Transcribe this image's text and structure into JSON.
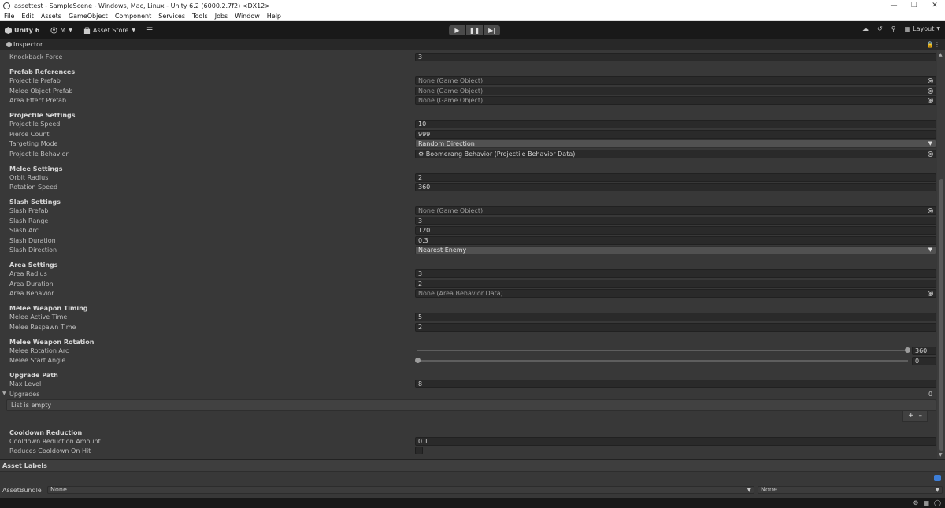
{
  "window": {
    "title": "assettest - SampleScene - Windows, Mac, Linux - Unity 6.2 (6000.2.7f2) <DX12>"
  },
  "menu": [
    "File",
    "Edit",
    "Assets",
    "GameObject",
    "Component",
    "Services",
    "Tools",
    "Jobs",
    "Window",
    "Help"
  ],
  "toolbar": {
    "unity_label": "Unity 6",
    "account_label": "M",
    "asset_store_label": "Asset Store",
    "layout_label": "Layout"
  },
  "inspector": {
    "tab_label": "Inspector"
  },
  "fields": {
    "knockback_force": {
      "label": "Knockback Force",
      "value": "3"
    },
    "prefab_references": "Prefab References",
    "projectile_prefab": {
      "label": "Projectile Prefab",
      "value": "None (Game Object)"
    },
    "melee_object_prefab": {
      "label": "Melee Object Prefab",
      "value": "None (Game Object)"
    },
    "area_effect_prefab": {
      "label": "Area Effect Prefab",
      "value": "None (Game Object)"
    },
    "projectile_settings": "Projectile Settings",
    "projectile_speed": {
      "label": "Projectile Speed",
      "value": "10"
    },
    "pierce_count": {
      "label": "Pierce Count",
      "value": "999"
    },
    "targeting_mode": {
      "label": "Targeting Mode",
      "value": "Random Direction"
    },
    "projectile_behavior": {
      "label": "Projectile Behavior",
      "value": "Boomerang Behavior (Projectile Behavior Data)"
    },
    "melee_settings": "Melee Settings",
    "orbit_radius": {
      "label": "Orbit Radius",
      "value": "2"
    },
    "rotation_speed": {
      "label": "Rotation Speed",
      "value": "360"
    },
    "slash_settings": "Slash Settings",
    "slash_prefab": {
      "label": "Slash Prefab",
      "value": "None (Game Object)"
    },
    "slash_range": {
      "label": "Slash Range",
      "value": "3"
    },
    "slash_arc": {
      "label": "Slash Arc",
      "value": "120"
    },
    "slash_duration": {
      "label": "Slash Duration",
      "value": "0.3"
    },
    "slash_direction": {
      "label": "Slash Direction",
      "value": "Nearest Enemy"
    },
    "area_settings": "Area Settings",
    "area_radius": {
      "label": "Area Radius",
      "value": "3"
    },
    "area_duration": {
      "label": "Area Duration",
      "value": "2"
    },
    "area_behavior": {
      "label": "Area Behavior",
      "value": "None (Area Behavior Data)"
    },
    "melee_weapon_timing": "Melee Weapon Timing",
    "melee_active_time": {
      "label": "Melee Active Time",
      "value": "5"
    },
    "melee_respawn_time": {
      "label": "Melee Respawn Time",
      "value": "2"
    },
    "melee_weapon_rotation": "Melee Weapon Rotation",
    "melee_rotation_arc": {
      "label": "Melee Rotation Arc",
      "value": "360",
      "fraction": 1.0
    },
    "melee_start_angle": {
      "label": "Melee Start Angle",
      "value": "0",
      "fraction": 0.0
    },
    "upgrade_path": "Upgrade Path",
    "max_level": {
      "label": "Max Level",
      "value": "8"
    },
    "upgrades": {
      "label": "Upgrades",
      "count": "0",
      "empty_text": "List is empty"
    },
    "cooldown_reduction": "Cooldown Reduction",
    "cooldown_reduction_amount": {
      "label": "Cooldown Reduction Amount",
      "value": "0.1"
    },
    "reduces_cooldown_on_hit": {
      "label": "Reduces Cooldown On Hit",
      "checked": false
    }
  },
  "asset_labels": {
    "title": "Asset Labels",
    "assetbundle_label": "AssetBundle",
    "bundle_value": "None",
    "variant_value": "None"
  },
  "colors": {
    "accent": "#3d7ed8",
    "background": "#383838",
    "toolbar": "#191919"
  }
}
